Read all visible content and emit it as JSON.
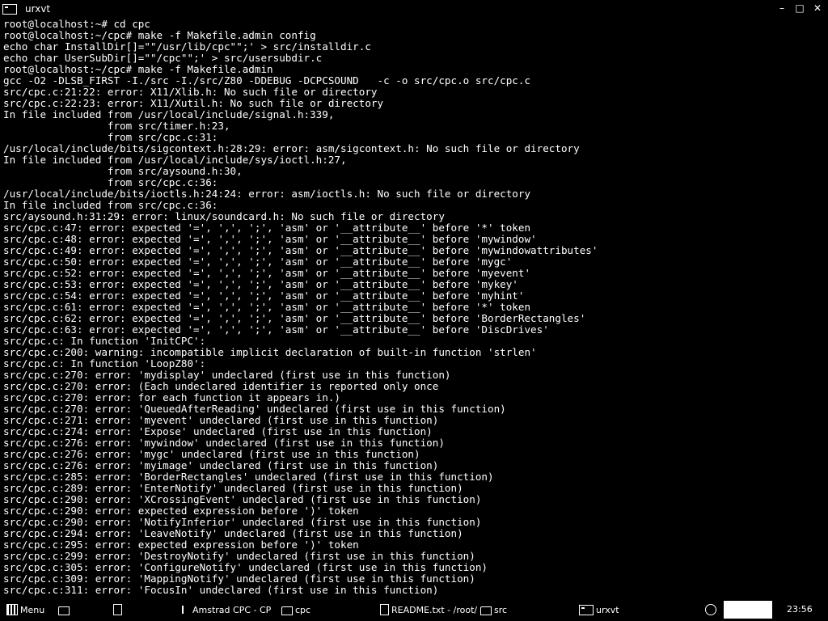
{
  "window": {
    "title": "urxvt",
    "controls": {
      "minimize": "–",
      "maximize": "□",
      "close": "✕"
    }
  },
  "terminal": {
    "lines": [
      "root@localhost:~# cd cpc",
      "root@localhost:~/cpc# make -f Makefile.admin config",
      "echo char InstallDir[]=\"\"/usr/lib/cpc\"\";' > src/installdir.c",
      "echo char UserSubDir[]=\"\"/cpc\"\";' > src/usersubdir.c",
      "root@localhost:~/cpc# make -f Makefile.admin",
      "gcc -O2 -DLSB_FIRST -I./src -I./src/Z80 -DDEBUG -DCPCSOUND   -c -o src/cpc.o src/cpc.c",
      "src/cpc.c:21:22: error: X11/Xlib.h: No such file or directory",
      "src/cpc.c:22:23: error: X11/Xutil.h: No such file or directory",
      "In file included from /usr/local/include/signal.h:339,",
      "                 from src/timer.h:23,",
      "                 from src/cpc.c:31:",
      "/usr/local/include/bits/sigcontext.h:28:29: error: asm/sigcontext.h: No such file or directory",
      "In file included from /usr/local/include/sys/ioctl.h:27,",
      "                 from src/aysound.h:30,",
      "                 from src/cpc.c:36:",
      "/usr/local/include/bits/ioctls.h:24:24: error: asm/ioctls.h: No such file or directory",
      "In file included from src/cpc.c:36:",
      "src/aysound.h:31:29: error: linux/soundcard.h: No such file or directory",
      "src/cpc.c:47: error: expected '=', ',', ';', 'asm' or '__attribute__' before '*' token",
      "src/cpc.c:48: error: expected '=', ',', ';', 'asm' or '__attribute__' before 'mywindow'",
      "src/cpc.c:49: error: expected '=', ',', ';', 'asm' or '__attribute__' before 'mywindowattributes'",
      "src/cpc.c:50: error: expected '=', ',', ';', 'asm' or '__attribute__' before 'mygc'",
      "src/cpc.c:52: error: expected '=', ',', ';', 'asm' or '__attribute__' before 'myevent'",
      "src/cpc.c:53: error: expected '=', ',', ';', 'asm' or '__attribute__' before 'mykey'",
      "src/cpc.c:54: error: expected '=', ',', ';', 'asm' or '__attribute__' before 'myhint'",
      "src/cpc.c:61: error: expected '=', ',', ';', 'asm' or '__attribute__' before '*' token",
      "src/cpc.c:62: error: expected '=', ',', ';', 'asm' or '__attribute__' before 'BorderRectangles'",
      "src/cpc.c:63: error: expected '=', ',', ';', 'asm' or '__attribute__' before 'DiscDrives'",
      "src/cpc.c: In function 'InitCPC':",
      "src/cpc.c:200: warning: incompatible implicit declaration of built-in function 'strlen'",
      "src/cpc.c: In function 'LoopZ80':",
      "src/cpc.c:270: error: 'mydisplay' undeclared (first use in this function)",
      "src/cpc.c:270: error: (Each undeclared identifier is reported only once",
      "src/cpc.c:270: error: for each function it appears in.)",
      "src/cpc.c:270: error: 'QueuedAfterReading' undeclared (first use in this function)",
      "src/cpc.c:271: error: 'myevent' undeclared (first use in this function)",
      "src/cpc.c:274: error: 'Expose' undeclared (first use in this function)",
      "src/cpc.c:276: error: 'mywindow' undeclared (first use in this function)",
      "src/cpc.c:276: error: 'mygc' undeclared (first use in this function)",
      "src/cpc.c:276: error: 'myimage' undeclared (first use in this function)",
      "src/cpc.c:285: error: 'BorderRectangles' undeclared (first use in this function)",
      "src/cpc.c:289: error: 'EnterNotify' undeclared (first use in this function)",
      "src/cpc.c:290: error: 'XCrossingEvent' undeclared (first use in this function)",
      "src/cpc.c:290: error: expected expression before ')' token",
      "src/cpc.c:290: error: 'NotifyInferior' undeclared (first use in this function)",
      "src/cpc.c:294: error: 'LeaveNotify' undeclared (first use in this function)",
      "src/cpc.c:295: error: expected expression before ')' token",
      "src/cpc.c:299: error: 'DestroyNotify' undeclared (first use in this function)",
      "src/cpc.c:305: error: 'ConfigureNotify' undeclared (first use in this function)",
      "src/cpc.c:309: error: 'MappingNotify' undeclared (first use in this function)",
      "src/cpc.c:311: error: 'FocusIn' undeclared (first use in this function)"
    ]
  },
  "taskbar": {
    "menu_label": "Menu",
    "tasks": [
      {
        "label": "Amstrad CPC - CP",
        "icon": "emulator-icon"
      },
      {
        "label": "cpc",
        "icon": "folder-icon"
      },
      {
        "label": "README.txt - /root/",
        "icon": "document-icon"
      },
      {
        "label": "src",
        "icon": "folder-icon"
      },
      {
        "label": "urxvt",
        "icon": "terminal-icon"
      }
    ],
    "clock": "23:56"
  }
}
